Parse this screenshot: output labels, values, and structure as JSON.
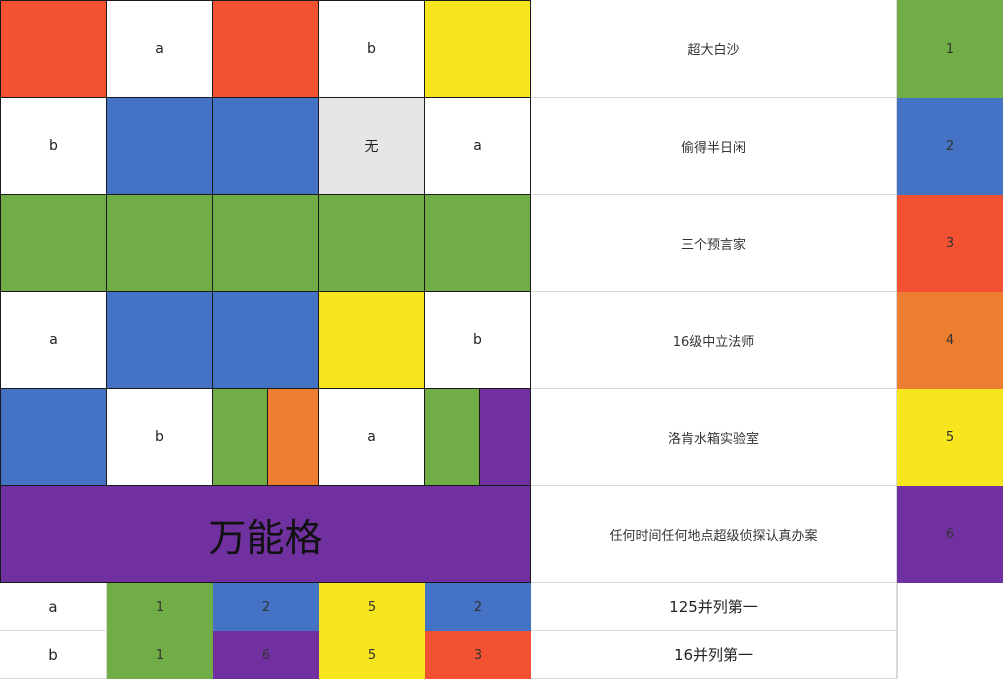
{
  "colors": {
    "red": "#F25132",
    "yellow": "#F7E51E",
    "blue": "#4472C4",
    "green": "#70AD47",
    "orange": "#ED7D31",
    "purple": "#7030A0",
    "gray": "#E6E6E6",
    "white": "#FFFFFF"
  },
  "board": {
    "row1": [
      "",
      "a",
      "",
      "b",
      ""
    ],
    "row2": [
      "b",
      "",
      "",
      "无",
      "a"
    ],
    "row4": [
      "a",
      "",
      "",
      "",
      "b"
    ],
    "row5": [
      "",
      "b",
      "",
      "",
      "a",
      "",
      ""
    ],
    "merged_label": "万能格"
  },
  "titles": [
    "超大白沙",
    "偷得半日闲",
    "三个预言家",
    "16级中立法师",
    "洛肯水箱实验室",
    "任何时间任何地点超级侦探认真办案"
  ],
  "legend": [
    "1",
    "2",
    "3",
    "4",
    "5",
    "6"
  ],
  "results": [
    {
      "player": "a",
      "cols": [
        "1",
        "2",
        "5",
        "2"
      ],
      "summary": "125并列第一"
    },
    {
      "player": "b",
      "cols": [
        "1",
        "6",
        "5",
        "3"
      ],
      "summary": "16并列第一"
    }
  ]
}
